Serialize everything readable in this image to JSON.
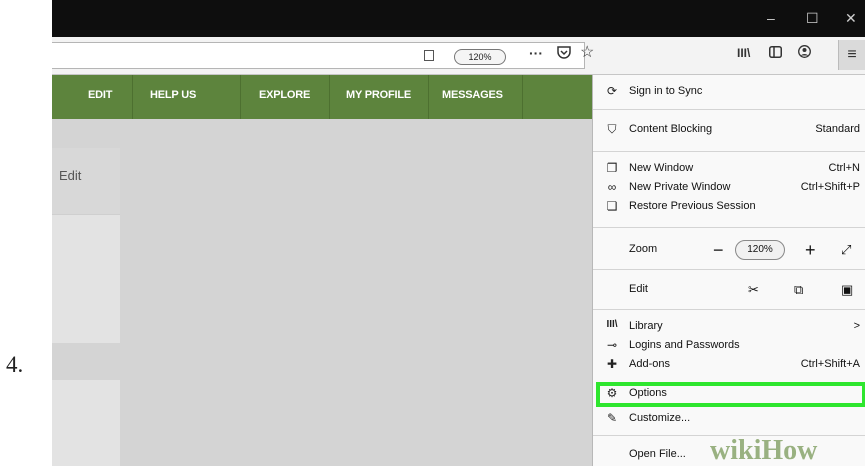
{
  "step": {
    "number": "4."
  },
  "window": {
    "minimize": "–",
    "maximize": "☐",
    "close": "✕"
  },
  "toolbar": {
    "zoom": "120%",
    "page_actions_icon": "ellipsis-icon",
    "pocket_icon": "pocket-icon",
    "bookmark_icon": "star-icon",
    "library_icon": "library-icon",
    "sidebar_icon": "sidebar-icon",
    "account_icon": "account-icon",
    "menu_icon": "hamburger-icon"
  },
  "nav": {
    "items": [
      "EDIT",
      "HELP US",
      "EXPLORE",
      "MY PROFILE",
      "MESSAGES"
    ]
  },
  "page": {
    "edit_link": "Edit"
  },
  "menu": {
    "sign_in": "Sign in to Sync",
    "content_blocking": "Content Blocking",
    "content_blocking_value": "Standard",
    "new_window": "New Window",
    "new_window_shortcut": "Ctrl+N",
    "new_private_window": "New Private Window",
    "new_private_window_shortcut": "Ctrl+Shift+P",
    "restore_session": "Restore Previous Session",
    "zoom_label": "Zoom",
    "zoom_minus": "−",
    "zoom_value": "120%",
    "zoom_plus": "+",
    "edit_label": "Edit",
    "library": "Library",
    "library_arrow": ">",
    "logins": "Logins and Passwords",
    "addons": "Add-ons",
    "addons_shortcut": "Ctrl+Shift+A",
    "options": "Options",
    "customize": "Customize...",
    "open_file": "Open File..."
  },
  "watermark": {
    "text": "wikiHow"
  },
  "colors": {
    "nav_bg": "#5d843d",
    "highlight": "#2ee62e",
    "titlebar": "#0e0e0e"
  }
}
